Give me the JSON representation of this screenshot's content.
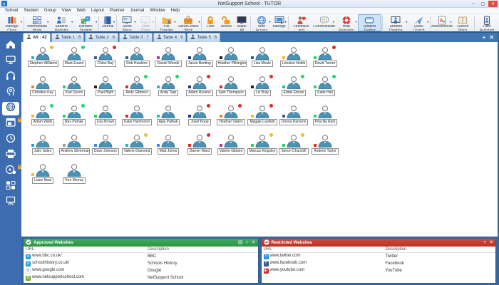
{
  "window": {
    "title": "NetSupport School : TUTOR"
  },
  "icons": {
    "minimize": "–",
    "maximize": "▢",
    "close": "✕",
    "dropdown": "▾",
    "tab_add": "+",
    "tab_close": "✕",
    "panel_export": "▤",
    "panel_add": "+",
    "panel_close": "✕"
  },
  "menu_bar": {
    "items": [
      "School",
      "Student",
      "Group",
      "View",
      "Web",
      "Layout",
      "Planner",
      "Journal",
      "Window",
      "Help"
    ]
  },
  "toolbar": {
    "groups": [
      [
        {
          "label": "Manage Class",
          "icon": "manage-class",
          "dropdown": true
        }
      ],
      [
        {
          "label": "Intermediate Mode",
          "icon": "intermediate-mode",
          "dropdown": true
        },
        {
          "label": "Student Register",
          "icon": "student-register",
          "dropdown": true
        },
        {
          "label": "Random Student",
          "icon": "random-student",
          "dropdown": true
        }
      ],
      [
        {
          "label": "Journal",
          "icon": "journal",
          "dropdown": true
        }
      ],
      [
        {
          "label": "Show Menu",
          "icon": "show-menu",
          "dropdown": true
        },
        {
          "label": "View Client",
          "icon": "view-client",
          "dropdown": true,
          "disabled": true
        }
      ],
      [
        {
          "label": "File Transfer",
          "icon": "file-transfer",
          "dropdown": true
        },
        {
          "label": "Send/Collect Work",
          "icon": "send-collect",
          "dropdown": true
        }
      ],
      [
        {
          "label": "Lock",
          "icon": "lock"
        },
        {
          "label": "Unlock",
          "icon": "unlock"
        },
        {
          "label": "Blank All",
          "icon": "blank-all"
        }
      ],
      [
        {
          "label": "Web Access",
          "icon": "web-access",
          "dropdown": true
        },
        {
          "label": "Manage",
          "icon": "manage",
          "dropdown": true
        }
      ],
      [
        {
          "label": "Feedback and Wellbeing",
          "icon": "feedback"
        },
        {
          "label": "Communicate",
          "icon": "communicate",
          "dropdown": true
        },
        {
          "label": "Help Requests",
          "icon": "help-requests",
          "dropdown": true
        },
        {
          "label": "Student Toolbar",
          "icon": "student-toolbar",
          "selected": true
        }
      ],
      [
        {
          "label": "Student Desktop",
          "icon": "student-desktop",
          "dropdown": true
        },
        {
          "label": "Quick Launch",
          "icon": "quick-launch",
          "dropdown": true
        }
      ],
      [
        {
          "label": "Assessments",
          "icon": "assessments",
          "dropdown": true
        },
        {
          "label": "Lesson Plans",
          "icon": "lesson-plans"
        }
      ],
      [
        {
          "label": "Tutor Assistant",
          "icon": "tutor-assistant"
        }
      ]
    ]
  },
  "sidebar": {
    "items": [
      {
        "id": "home",
        "icon": "home"
      },
      {
        "id": "monitor-mode",
        "icon": "monitor"
      },
      {
        "id": "audio-mode",
        "icon": "headphones"
      },
      {
        "id": "wellbeing-mode",
        "icon": "head"
      },
      {
        "id": "web-control",
        "icon": "globe",
        "active": true
      },
      {
        "id": "application-control",
        "icon": "app-window",
        "lock": true
      },
      {
        "id": "time-mode",
        "icon": "clock"
      },
      {
        "id": "print-management",
        "icon": "printer"
      },
      {
        "id": "device-control",
        "icon": "disc",
        "lock": true
      },
      {
        "id": "qa-mode",
        "icon": "qa"
      },
      {
        "id": "whiteboard-mode",
        "icon": "whiteboard"
      }
    ]
  },
  "tab_bar": {
    "tabs": [
      {
        "label": "All : 42",
        "active": true
      },
      {
        "label": "Table 1 : 6"
      },
      {
        "label": "Table 2 : 6"
      },
      {
        "label": "Table 3 : 7"
      },
      {
        "label": "Table 4 : 9"
      },
      {
        "label": "Table 5 : 6"
      }
    ]
  },
  "students": {
    "items": [
      {
        "name": "Stephen Williams",
        "badge_top": "#f5b82e",
        "badge_bottom": "#2bb6c4"
      },
      {
        "name": "Mark Evans",
        "badge_top": "#25d366"
      },
      {
        "name": "Chloe Bay",
        "badge_top": "#e02b20",
        "badge_bottom": "#3b5998"
      },
      {
        "name": "Rob Hawkins",
        "badge_bottom": "#3b5998"
      },
      {
        "name": "Daniel Woods",
        "badge_bottom": "#b13589"
      },
      {
        "name": "Jason Bunting",
        "badge_bottom": "#1a3e72"
      },
      {
        "name": "Heather Pilkington",
        "badge_bottom": "#222222"
      },
      {
        "name": "Lisa Moule",
        "badge_bottom": "#3b5998"
      },
      {
        "name": "Lorraine Noble",
        "badge_bottom": "#f5b82e"
      },
      {
        "name": "David Turner",
        "badge_top": "#e02b20",
        "badge_bottom": "#25d366"
      },
      {
        "name": "Christine Kay",
        "badge_bottom": "#e8862d"
      },
      {
        "name": "Karl Dyson",
        "badge_bottom": "#25d366"
      },
      {
        "name": "Paul Blyth",
        "badge_bottom": "#222222"
      },
      {
        "name": "Andy Gibbons",
        "badge_top": "#25d366",
        "badge_bottom": "#e02b20"
      },
      {
        "name": "Andy Tarp",
        "badge_top": "#25d366",
        "badge_bottom": "#2bb6c4"
      },
      {
        "name": "Adam Rosens",
        "badge_top": "#e02b20",
        "badge_bottom": "#1a3e72"
      },
      {
        "name": "Sam Thompson",
        "badge_bottom": "#e02b20"
      },
      {
        "name": "Liz Bury",
        "badge_top": "#e02b20",
        "badge_bottom": "#222222"
      },
      {
        "name": "Eddie Emore",
        "badge_top": "#25d366",
        "badge_bottom": "#2bb6c4"
      },
      {
        "name": "Katie Hall",
        "badge_top": "#25d366",
        "badge_bottom": "#25d366"
      },
      {
        "name": "Adam Walls",
        "badge_top": "#25d366",
        "badge_bottom": "#f5b82e"
      },
      {
        "name": "Rav Pathak",
        "badge_top": "#25d366",
        "badge_bottom": "#25d366"
      },
      {
        "name": "Lisa Brown",
        "badge_bottom": "#25d366"
      },
      {
        "name": "Katie Hammond",
        "badge_bottom": "#e02b20"
      },
      {
        "name": "Ajay Pathak",
        "badge_bottom": "#2bb6c4"
      },
      {
        "name": "Josef Kopp",
        "badge_top": "#e02b20",
        "badge_bottom": "#1a3e72"
      },
      {
        "name": "Heather Vaters",
        "badge_top": "#e02b20",
        "badge_bottom": "#e8862d"
      },
      {
        "name": "Maggie Layfield",
        "badge_top": "#e02b20",
        "badge_bottom": "#f5b82e"
      },
      {
        "name": "Donna Parsons",
        "badge_bottom": "#3b5998"
      },
      {
        "name": "Priscilla Rain",
        "badge_bottom": "#25d366"
      },
      {
        "name": "Julie Sales",
        "badge_bottom": "#1da1f2"
      },
      {
        "name": "Andrew Silverman",
        "badge_bottom": "#9aa0a6"
      },
      {
        "name": "Dave Johnson",
        "badge_bottom": "#4285F4"
      },
      {
        "name": "Valerie Diamond",
        "badge_top": "#f5b82e",
        "badge_bottom": "#2bb6c4"
      },
      {
        "name": "Matt Jones",
        "badge_bottom": "#4285F4"
      },
      {
        "name": "Darren Ward",
        "badge_top": "#e02b20",
        "badge_bottom": "#e02b20"
      },
      {
        "name": "Valerie Gibbon",
        "badge_bottom": "#b13589"
      },
      {
        "name": "Marcus Kingsley",
        "badge_top": "#f5b82e",
        "badge_bottom": "#25d366"
      },
      {
        "name": "Simon Churchill",
        "badge_top": "#f5b82e",
        "badge_bottom": "#25d366"
      },
      {
        "name": "Andrew Taylor",
        "badge_bottom": "#e02b20"
      },
      {
        "name": "Liane Neal",
        "badge_bottom": "#f5b82e"
      },
      {
        "name": "Tom Murray"
      }
    ]
  },
  "approved_websites": {
    "title": "Approved Websites",
    "header_color": "#35a24b",
    "columns": [
      "URL",
      "Description"
    ],
    "rows": [
      {
        "url": "www.bbc.co.uk/",
        "description": "BBC",
        "favicon": "ie",
        "fav_bg": "#29abe2",
        "fav_fg": "#ffffff",
        "fav_glyph": "e"
      },
      {
        "url": "schoolhistory.co.uk/",
        "description": "Schools History",
        "favicon": "ie",
        "fav_bg": "#29abe2",
        "fav_fg": "#ffffff",
        "fav_glyph": "e"
      },
      {
        "url": "www.google.com",
        "description": "Google",
        "favicon": "google",
        "fav_bg": "#ffffff",
        "fav_fg": "#4285F4",
        "fav_glyph": "G"
      },
      {
        "url": "www.netsupportschool.com",
        "description": "NetSupport School",
        "favicon": "netsupport",
        "fav_bg": "#7cb82f",
        "fav_fg": "#ffffff",
        "fav_glyph": "N"
      }
    ]
  },
  "restricted_websites": {
    "title": "Restricted Websites",
    "header_color": "#c63a2f",
    "columns": [
      "URL",
      "Description"
    ],
    "rows": [
      {
        "url": "www.twitter.com",
        "description": "Twitter",
        "favicon": "twitter",
        "fav_bg": "#1da1f2",
        "fav_fg": "#ffffff",
        "fav_glyph": "t"
      },
      {
        "url": "www.facebook.com",
        "description": "Facebook",
        "favicon": "facebook",
        "fav_bg": "#3b5998",
        "fav_fg": "#ffffff",
        "fav_glyph": "f"
      },
      {
        "url": "www.youtube.com",
        "description": "YouTube",
        "favicon": "youtube",
        "fav_bg": "#e02b20",
        "fav_fg": "#ffffff",
        "fav_glyph": "▶"
      }
    ]
  }
}
